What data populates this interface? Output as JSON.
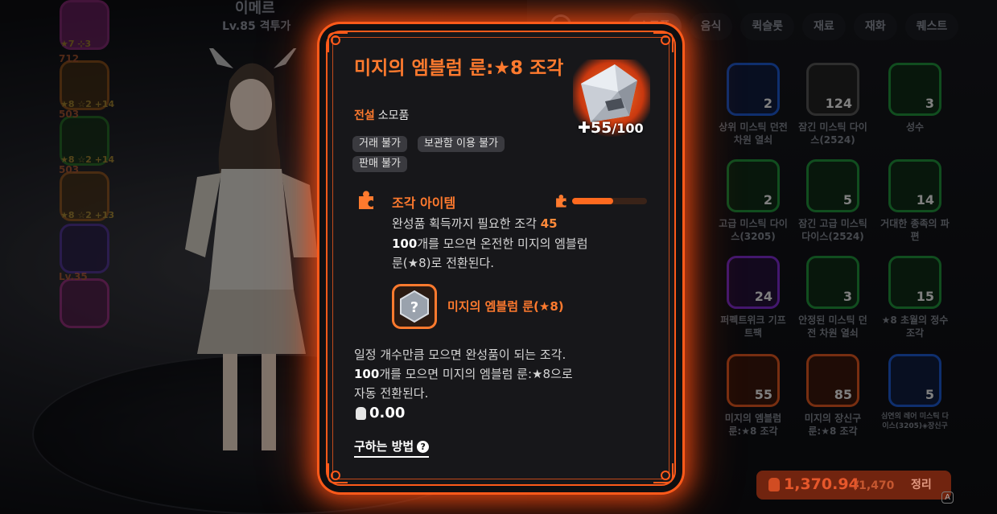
{
  "character": {
    "name": "이메르",
    "level": "Lv.85 격투가"
  },
  "party": [
    {
      "level": "",
      "stars": "★7 ⊹3"
    },
    {
      "level": "712",
      "stars": "★8 ☆2 +14"
    },
    {
      "level": "503",
      "stars": "★8 ☆2 +14"
    },
    {
      "level": "503",
      "stars": "★8 ☆2 +13"
    },
    {
      "level": "",
      "stars": ""
    },
    {
      "level": "Lv.35",
      "stars": ""
    }
  ],
  "tabs": [
    "소모품",
    "음식",
    "퀵슬롯",
    "재료",
    "재화",
    "퀘스트"
  ],
  "inventory": [
    {
      "name": "상위 미스틱 던전 차원 열쇠",
      "count": "2",
      "rarity": "blue"
    },
    {
      "name": "잠긴 미스틱 다이스(2524)",
      "count": "124",
      "rarity": "gray"
    },
    {
      "name": "성수",
      "count": "3",
      "rarity": "green"
    },
    {
      "name": "고급 미스틱 다이스(3205)",
      "count": "2",
      "rarity": "green"
    },
    {
      "name": "잠긴 고급 미스틱 다이스(2524)",
      "count": "5",
      "rarity": "green"
    },
    {
      "name": "거대한 종족의 파편",
      "count": "14",
      "rarity": "green"
    },
    {
      "name": "퍼펙트위크 기프트팩",
      "count": "24",
      "rarity": "purple"
    },
    {
      "name": "안정된 미스틱 던전 차원 열쇠",
      "count": "3",
      "rarity": "green"
    },
    {
      "name": "★8 초월의 정수 조각",
      "count": "15",
      "rarity": "green"
    },
    {
      "name": "미지의 엠블럼 룬:★8 조각",
      "count": "55",
      "rarity": "orange"
    },
    {
      "name": "미지의 장신구 룬:★8 조각",
      "count": "85",
      "rarity": "orange"
    },
    {
      "name": "심연의 레어 미스틱 다이스(3205)◈장신구",
      "count": "5",
      "rarity": "blue"
    }
  ],
  "wallet": {
    "value": "1,370.94",
    "max": "/1,470",
    "sort_label": "정리",
    "hotkey": "A"
  },
  "tooltip": {
    "title": "미지의 엠블럼 룬:★8 조각",
    "grade": "전설",
    "category": "소모품",
    "tags": [
      "거래 불가",
      "보관함 이용 불가",
      "판매 불가"
    ],
    "owned": "55",
    "required_total": "/100",
    "fragment_label": "조각 아이템",
    "progress_fraction": 0.55,
    "needed_prefix": "완성품 획득까지 필요한 조각",
    "needed_count": "45",
    "convert_count": "100",
    "convert_line1": "개를 모으면 온전한 미지의 엠블럼",
    "convert_line2": "룬(★8)로 전환된다.",
    "result_name": "미지의 엠블럼 룬(★8)",
    "desc_line1": "일정 개수만큼 모으면 완성품이 되는 조각.",
    "desc_count": "100",
    "desc_line2": "개를 모으면 미지의 엠블럼 룬:★8으로",
    "desc_line3": "자동 전환된다.",
    "price": "0.00",
    "how_to_label": "구하는 방법",
    "accent_color": "#ff7a2e"
  }
}
